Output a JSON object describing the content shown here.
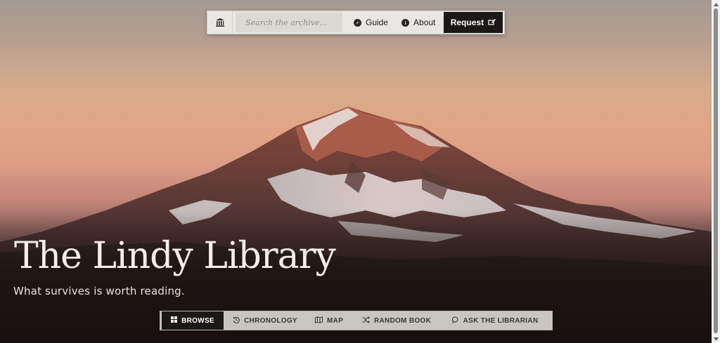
{
  "header": {
    "search": {
      "placeholder": "Search the archive..."
    },
    "links": [
      {
        "label": "Guide",
        "icon": "compass-icon"
      },
      {
        "label": "About",
        "icon": "info-icon"
      }
    ],
    "request": {
      "label": "Request",
      "icon": "pencil-box-icon"
    },
    "logo_icon": "library-building-icon"
  },
  "hero": {
    "title": "The Lindy Library",
    "tagline": "What survives is worth reading.",
    "image": "snow-capped mountain at sunset"
  },
  "bottom_nav": {
    "items": [
      {
        "label": "BROWSE",
        "icon": "grid-icon",
        "active": true
      },
      {
        "label": "CHRONOLOGY",
        "icon": "history-icon",
        "active": false
      },
      {
        "label": "MAP",
        "icon": "map-icon",
        "active": false
      },
      {
        "label": "RANDOM BOOK",
        "icon": "shuffle-icon",
        "active": false
      },
      {
        "label": "ASK THE LIBRARIAN",
        "icon": "chat-icon",
        "active": false
      }
    ]
  },
  "colors": {
    "accent_dark": "#1b1816",
    "nav_bg": "#e9e7e3",
    "bottom_nav_bg": "#c9c6c2"
  }
}
